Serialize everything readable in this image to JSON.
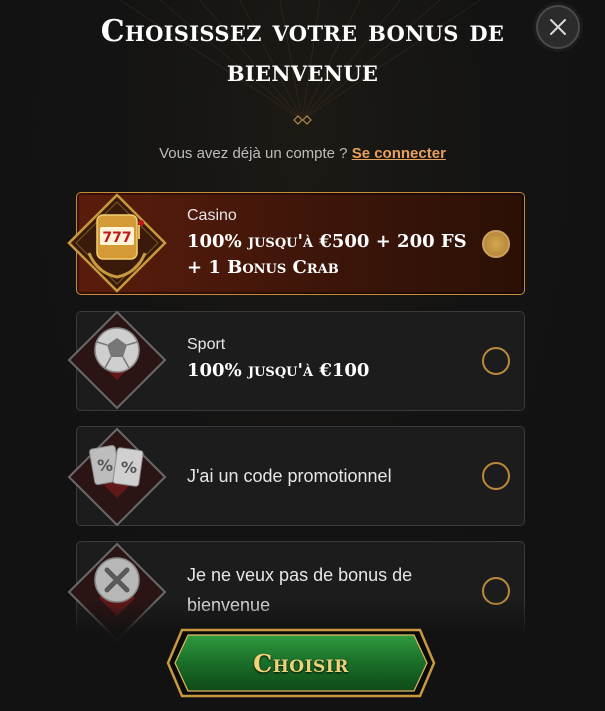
{
  "modal": {
    "title": "Choisissez votre bonus de bienvenue",
    "close_icon": "close-icon"
  },
  "login": {
    "prompt": "Vous avez déjà un compte ?",
    "link": "Se connecter"
  },
  "options": [
    {
      "id": "casino",
      "label": "Casino",
      "offer": "100% jusqu'à €500 + 200 FS + 1 Bonus Crab",
      "icon": "slot-machine-icon",
      "selected": true
    },
    {
      "id": "sport",
      "label": "Sport",
      "offer": "100% jusqu'à €100",
      "icon": "soccer-ball-icon",
      "selected": false
    },
    {
      "id": "promo",
      "text": "J'ai un code promotionnel",
      "icon": "promo-code-icon",
      "selected": false
    },
    {
      "id": "none",
      "text": "Je ne veux pas de bonus de bienvenue",
      "icon": "no-bonus-icon",
      "selected": false
    }
  ],
  "submit": {
    "label": "Choisir"
  },
  "colors": {
    "accent_gold": "#c58a3a",
    "link": "#e8a05c",
    "selected_bg": "#5a1d0c",
    "button_green": "#1f7a2e"
  }
}
